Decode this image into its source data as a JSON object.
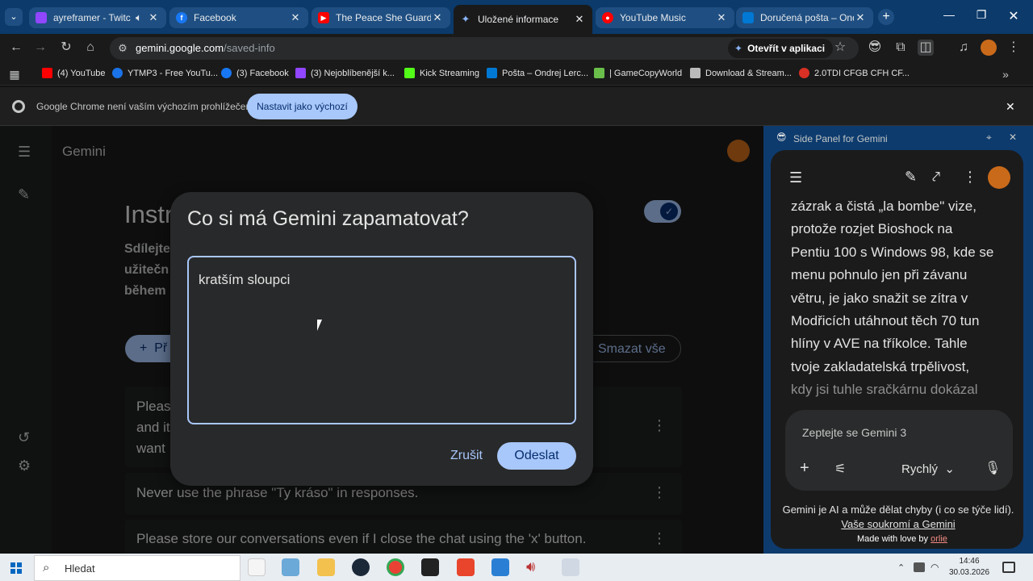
{
  "browser": {
    "tabs": [
      {
        "title": "ayreframer - Twitch",
        "favicon": "twitch-icon",
        "color": "#9146ff",
        "active": false
      },
      {
        "title": "Facebook",
        "favicon": "facebook-icon",
        "color": "#1877f2",
        "active": false
      },
      {
        "title": "The Peace She Guards |",
        "favicon": "youtube-icon",
        "color": "#ff0000",
        "active": false
      },
      {
        "title": "Uložené informace",
        "favicon": "gemini-icon",
        "color": "#4285f4",
        "active": true
      },
      {
        "title": "YouTube Music",
        "favicon": "youtube-music-icon",
        "color": "#ff0000",
        "active": false
      },
      {
        "title": "Doručená pošta – Ondr",
        "favicon": "outlook-icon",
        "color": "#0078d4",
        "active": false
      }
    ],
    "url_host": "gemini.google.com",
    "url_path": "/saved-info",
    "open_in_app_label": "Otevřít v aplikaci",
    "bookmarks": [
      {
        "label": "(4) YouTube",
        "color": "#ff0000"
      },
      {
        "label": "YTMP3 - Free YouTu...",
        "color": "#1a73e8"
      },
      {
        "label": "(3) Facebook",
        "color": "#1877f2"
      },
      {
        "label": "(3) Nejoblíbenější k...",
        "color": "#9146ff"
      },
      {
        "label": "Kick Streaming",
        "color": "#53fc18"
      },
      {
        "label": "Pošta – Ondrej Lerc...",
        "color": "#0078d4"
      },
      {
        "label": "| GameCopyWorld",
        "color": "#6abf4b"
      },
      {
        "label": "Download & Stream...",
        "color": "#bbbbbb"
      },
      {
        "label": "2.0TDI CFGB CFH CF...",
        "color": "#d93025"
      }
    ],
    "infobar": {
      "text": "Google Chrome není vaším výchozím prohlížečem",
      "button": "Nastavit jako výchozí"
    }
  },
  "gemini": {
    "brand": "Gemini",
    "page_title_partial": "Instr",
    "description_partial": [
      "Sdílejte",
      "užitečn",
      "během"
    ],
    "add_button_partial": "Př",
    "delete_all_label": "Smazat vše",
    "rules": [
      {
        "text_line1": "Please",
        "text_line2": "and it",
        "text_line3": "want"
      },
      {
        "text": "Never use the phrase \"Ty kráso\" in responses."
      },
      {
        "text": "Please store our conversations even if I close the chat using the 'x' button."
      }
    ]
  },
  "dialog": {
    "title": "Co si má Gemini zapamatovat?",
    "value": "kratším sloupci",
    "cancel_label": "Zrušit",
    "submit_label": "Odeslat"
  },
  "side_panel": {
    "title": "Side Panel for Gemini",
    "message_lines": [
      "zázrak a čistá „la bombe\" vize,",
      "protože rozjet Bioshock na",
      "Pentiu 100 s Windows 98, kde se",
      "menu pohnulo jen při závanu",
      "větru, je jako snažit se zítra v",
      "Modřicích utáhnout těch 70 tun",
      "hlíny v AVE na tříkolce. Tahle",
      "tvoje zakladatelská trpělivost,",
      "kdy jsi tuhle sračkárnu dokázal"
    ],
    "input_placeholder": "Zeptejte se Gemini 3",
    "mode_label": "Rychlý",
    "disclaimer": "Gemini je AI a může dělat chyby (i co se týče lidí).",
    "privacy_link": "Vaše soukromí a Gemini",
    "made_with": "Made with love by",
    "made_with_author": "orlie"
  },
  "taskbar": {
    "search_label": "Hledat",
    "time": "14:46",
    "date": "30.03.2026"
  }
}
